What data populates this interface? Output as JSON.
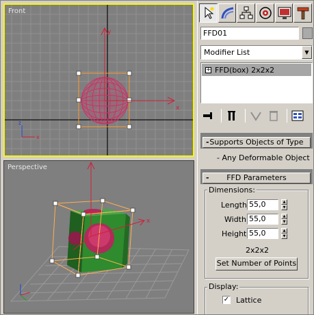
{
  "viewports": {
    "front": {
      "label": "Front"
    },
    "perspective": {
      "label": "Perspective"
    }
  },
  "command_panel": {
    "tabs": [
      {
        "name": "create-tab",
        "icon": "cursor-icon"
      },
      {
        "name": "modify-tab",
        "icon": "bend-icon"
      },
      {
        "name": "hierarchy-tab",
        "icon": "hierarchy-icon"
      },
      {
        "name": "motion-tab",
        "icon": "motion-icon"
      },
      {
        "name": "display-tab",
        "icon": "display-icon"
      },
      {
        "name": "utilities-tab",
        "icon": "hammer-icon"
      }
    ],
    "object_name": "FFD01",
    "modifier_list": "Modifier List",
    "stack": [
      {
        "label": "FFD(box) 2x2x2",
        "expand": "+"
      }
    ]
  },
  "rollouts": {
    "supports": {
      "title": "Supports Objects of Type",
      "sign": "-",
      "body": "- Any Deformable Object"
    },
    "ffd_params": {
      "title": "FFD Parameters",
      "sign": "-",
      "dimensions_label": "Dimensions:",
      "length_label": "Length:",
      "length_value": "55,0",
      "width_label": "Width:",
      "width_value": "55,0",
      "height_label": "Height:",
      "height_value": "55,0",
      "points_text": "2x2x2",
      "set_points_button": "Set Number of Points",
      "display_label": "Display:",
      "lattice_label": "Lattice",
      "lattice_checked": "✓"
    }
  },
  "colors": {
    "active_viewport_border": "#f7f700",
    "viewport_bg": "#7f7f7f",
    "sphere": "#cc3366",
    "box_green": "#2e8b2e",
    "gizmo": "#ff9a2e"
  }
}
